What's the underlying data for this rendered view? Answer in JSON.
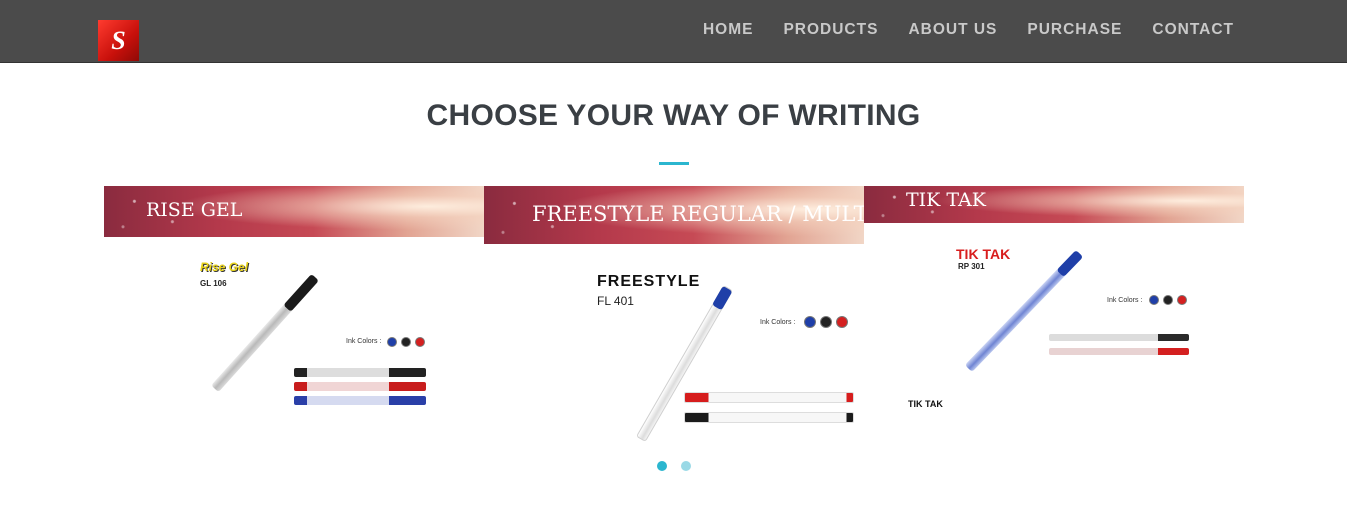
{
  "header": {
    "logo_letter": "S",
    "nav": [
      "HOME",
      "PRODUCTS",
      "ABOUT US",
      "PURCHASE",
      "CONTACT"
    ]
  },
  "main": {
    "title": "CHOOSE YOUR WAY OF WRITING",
    "accent_color": "#2bb6cf"
  },
  "carousel": {
    "cards": [
      {
        "title": "RISE GEL",
        "brand": "Rise Gel",
        "code": "GL 106",
        "ink_label": "Ink Colors :",
        "ink_colors": [
          "#1f3fa8",
          "#222222",
          "#d42020"
        ]
      },
      {
        "title": "FREESTYLE REGULAR / MULTI",
        "brand": "FREESTYLE",
        "code": "FL 401",
        "ink_label": "Ink Colors :",
        "ink_colors": [
          "#1f3fa8",
          "#222222",
          "#d42020"
        ]
      },
      {
        "title": "TIK TAK",
        "brand": "TIK TAK",
        "code": "RP 301",
        "ink_label": "Ink Colors :",
        "ink_colors": [
          "#1f3fa8",
          "#222222",
          "#d42020"
        ],
        "caption": "TIK TAK"
      }
    ],
    "pager": {
      "active": 1,
      "total": 2
    }
  }
}
